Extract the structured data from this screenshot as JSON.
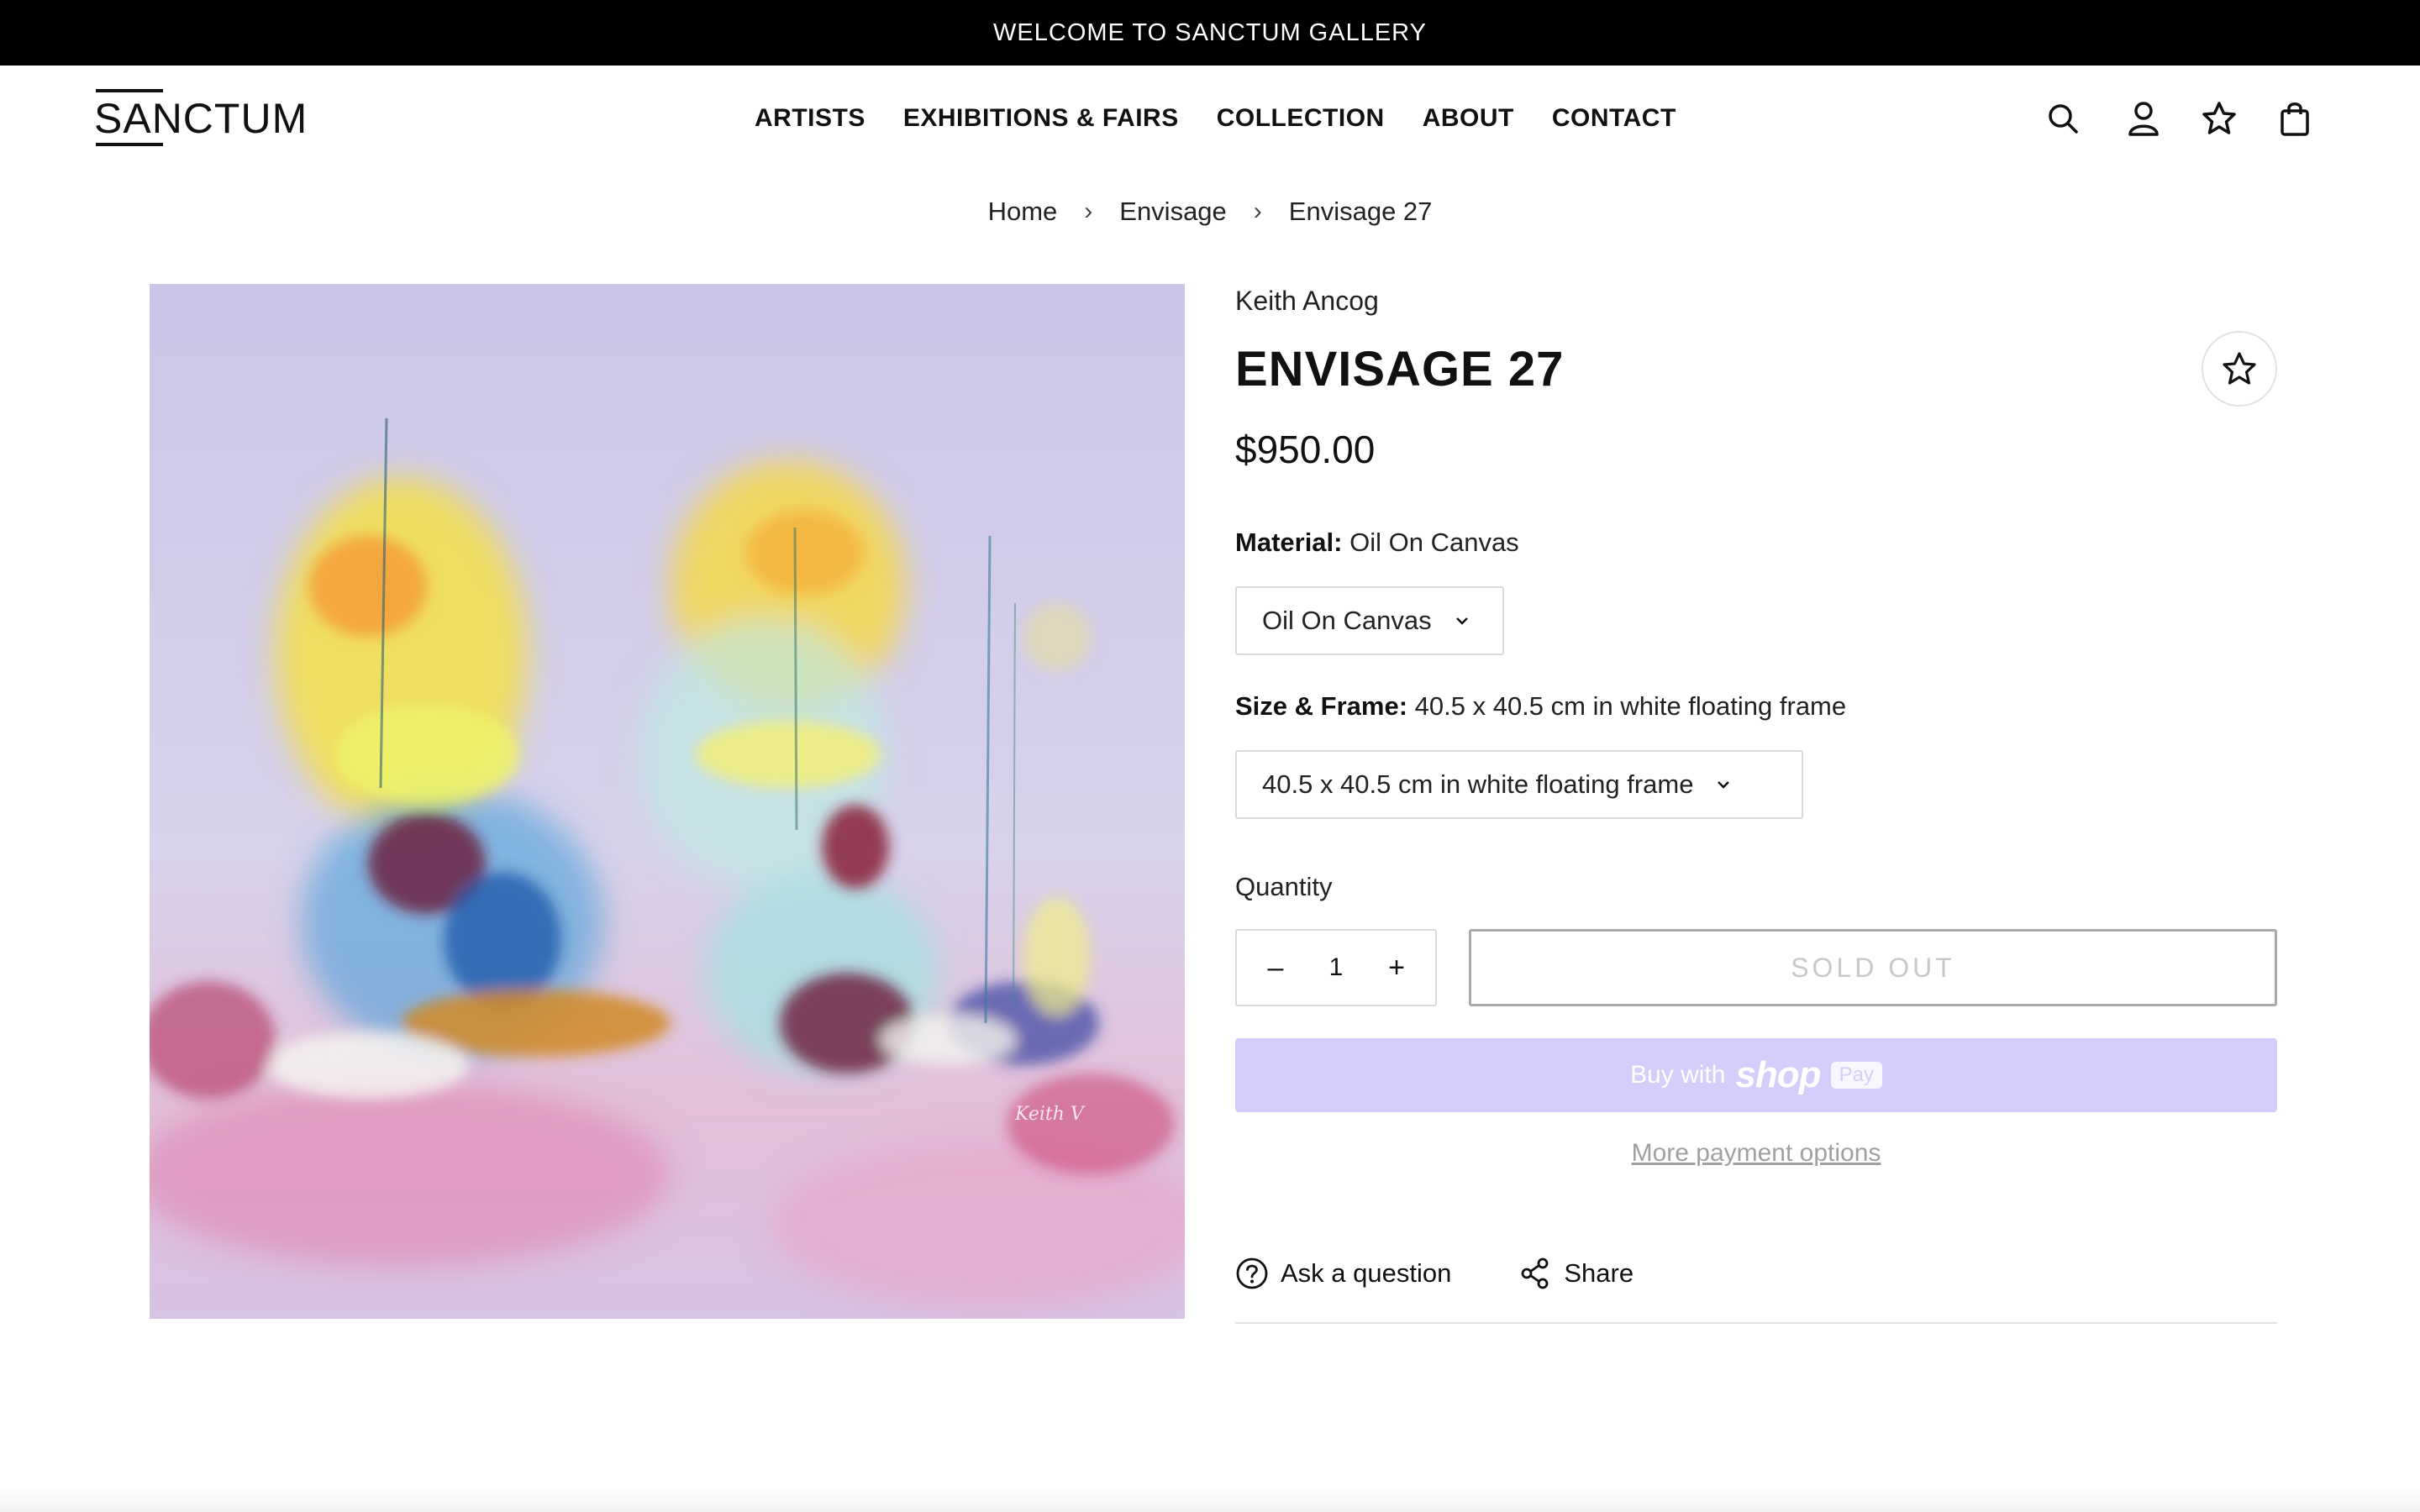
{
  "announcement": "WELCOME TO SANCTUM GALLERY",
  "header": {
    "logo": "SANCTUM",
    "nav": [
      "ARTISTS",
      "EXHIBITIONS & FAIRS",
      "COLLECTION",
      "ABOUT",
      "CONTACT"
    ],
    "icons": [
      "search-icon",
      "account-icon",
      "wishlist-star-icon",
      "bag-icon"
    ]
  },
  "breadcrumb": [
    "Home",
    "Envisage",
    "Envisage 27"
  ],
  "product": {
    "artist": "Keith Ancog",
    "title": "ENVISAGE 27",
    "price": "$950.00",
    "material_label": "Material:",
    "material_value": "Oil On Canvas",
    "material_selected": "Oil On Canvas",
    "size_label": "Size & Frame:",
    "size_value": "40.5 x 40.5 cm in white floating frame",
    "size_selected": "40.5 x 40.5 cm in white floating frame",
    "quantity_label": "Quantity",
    "quantity": "1",
    "sold_out": "SOLD OUT",
    "shoppay_prefix": "Buy with",
    "shoppay_brand": "shop",
    "shoppay_pay": "Pay",
    "more_payment": "More payment options",
    "ask": "Ask a question",
    "share": "Share"
  },
  "colors": {
    "announcement_bg": "#000000",
    "shoppay_bg": "#d6cdfa",
    "soldout_text": "#c8c8c8"
  }
}
